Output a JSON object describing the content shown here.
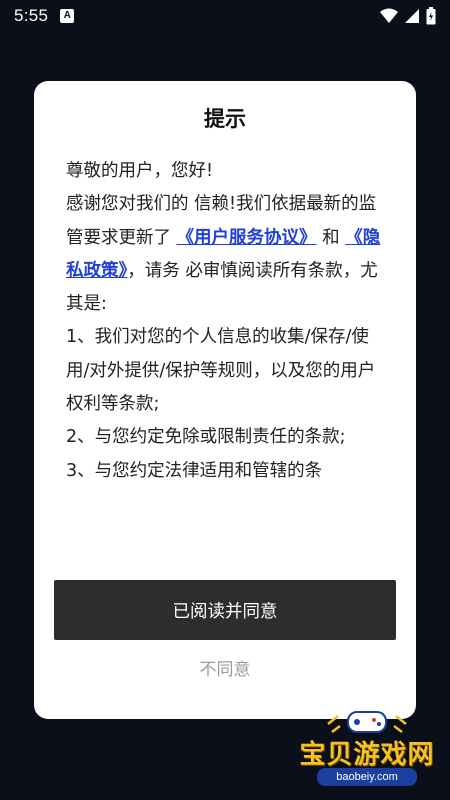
{
  "status_bar": {
    "time": "5:55",
    "app_icon_letter": "A",
    "icons": [
      "wifi-icon",
      "signal-icon",
      "battery-icon"
    ]
  },
  "dialog": {
    "title": "提示",
    "greeting": "尊敬的用户，您好!",
    "paragraph_before_links": "感谢您对我们的 信赖!我们依据最新的监管要求更新了 ",
    "link_user_agreement": "《用户服务协议》",
    "connector": " 和 ",
    "link_privacy_policy": "《隐私政策》",
    "paragraph_after_links": "，请务 必审慎阅读所有条款，尤其是:",
    "items": [
      " 1、我们对您的个人信息的收集/保存/使 用/对外提供/保护等规则，以及您的用户 权利等条款;",
      " 2、与您约定免除或限制责任的条款;",
      " 3、与您约定法律适用和管辖的条"
    ],
    "agree_button": "已阅读并同意",
    "disagree_button": "不同意"
  },
  "watermark": {
    "text": "宝贝游戏网",
    "url": "baobeiy.com"
  },
  "colors": {
    "background": "#0b0f1a",
    "dialog": "#ffffff",
    "link": "#1f3fd6",
    "agree_button": "#2d2d2f",
    "disagree_text": "#9b9b9b",
    "watermark": "#f4c323"
  }
}
